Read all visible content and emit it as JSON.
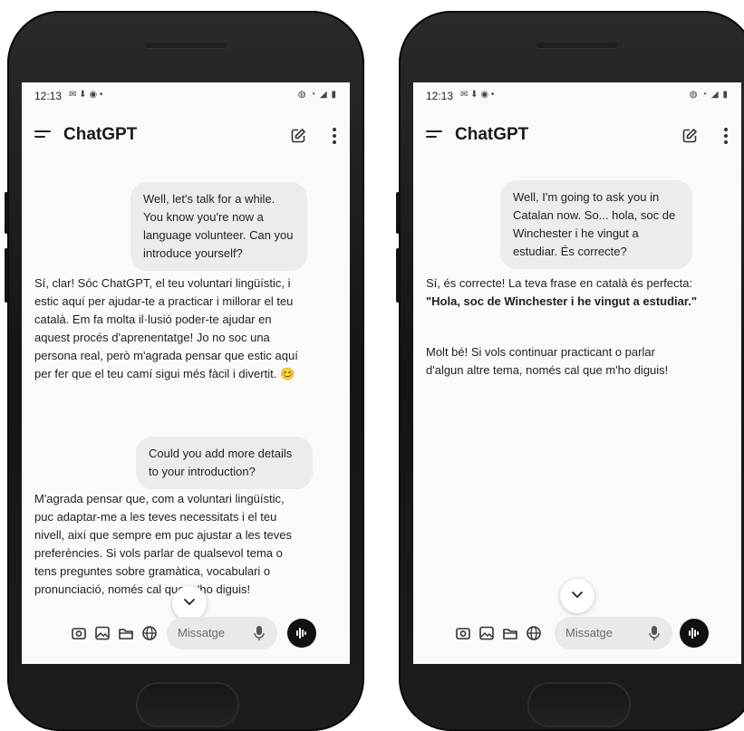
{
  "left_phone": {
    "status_time": "12:13",
    "status_icons": "✉ ⬇ ◉ •",
    "status_right": "◍ ◔ ◢ ▮",
    "app_title": "ChatGPT",
    "user_message_1": "Well, let's talk for a while. You know you're now a language volunteer. Can you introduce yourself?",
    "bot_message_1": "Sí, clar! Sóc ChatGPT, el teu voluntari lingüístic, i estic aquí per ajudar-te a practicar i millorar el teu català. Em fa molta il·lusió poder-te ajudar en aquest procés d'aprenentatge! Jo no soc una persona real, però m'agrada pensar que estic aquí per fer que el teu camí sigui més fàcil i divertit. 😊",
    "user_message_2": "Could you add more details to your introduction?",
    "bot_message_2": "M'agrada pensar que, com a voluntari lingüístic, puc adaptar-me a les teves necessitats i el teu nivell, així que sempre em puc ajustar a les teves preferències. Si vols parlar de qualsevol tema o tens preguntes sobre gramàtica, vocabulari o pronunciació, només cal que m'ho diguis!",
    "input_placeholder": "Missatge"
  },
  "right_phone": {
    "status_time": "12:13",
    "status_icons": "✉ ⬇ ◉ •",
    "status_right": "◍ ◔ ◢ ▮",
    "app_title": "ChatGPT",
    "user_message_1": "Well, I'm going to ask you in Catalan now. So... hola, soc de Winchester i he vingut a estudiar. És correcte?",
    "bot_message_1_intro": "Sí, és correcte! La teva frase en català és perfecta: ",
    "bot_message_1_bold": "\"Hola, soc de Winchester i he vingut a estudiar.\"",
    "bot_message_2": "Molt bé! Si vols continuar practicant o parlar d'algun altre tema, només cal que m'ho diguis!",
    "input_placeholder": "Missatge"
  },
  "icons": {
    "menu": "menu-icon",
    "edit": "edit-icon",
    "more": "more-vertical-icon",
    "camera": "camera-icon",
    "image": "image-icon",
    "folder": "folder-icon",
    "globe": "globe-icon",
    "mic": "microphone-icon",
    "voice": "voice-mode-icon",
    "scroll": "chevron-down-icon"
  }
}
